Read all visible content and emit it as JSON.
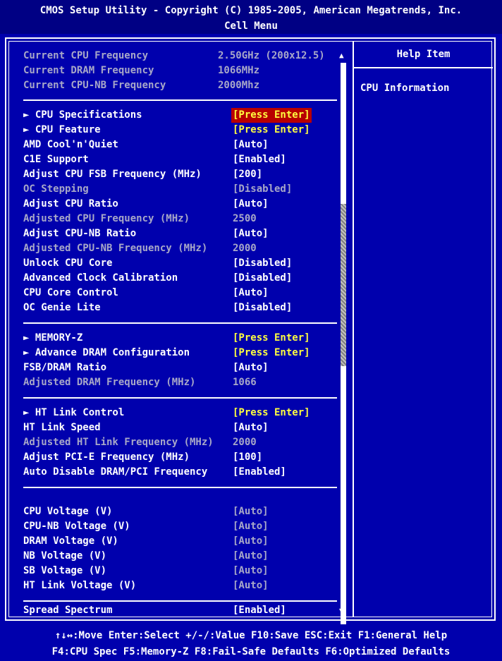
{
  "header": {
    "line1": "CMOS Setup Utility - Copyright (C) 1985-2005, American Megatrends, Inc.",
    "line2": "Cell Menu"
  },
  "help": {
    "title": "Help Item",
    "text": "CPU Information"
  },
  "info": [
    {
      "label": "Current CPU Frequency",
      "value": "2.50GHz (200x12.5)"
    },
    {
      "label": "Current DRAM Frequency",
      "value": "1066MHz"
    },
    {
      "label": "Current CPU-NB Frequency",
      "value": "2000Mhz"
    }
  ],
  "items": {
    "cpu_spec": {
      "label": "► CPU Specifications",
      "value": "[Press Enter]"
    },
    "cpu_feature": {
      "label": "► CPU Feature",
      "value": "[Press Enter]"
    },
    "cool_quiet": {
      "label": "AMD Cool'n'Quiet",
      "value": "[Auto]"
    },
    "c1e": {
      "label": "C1E Support",
      "value": "[Enabled]"
    },
    "fsb": {
      "label": "Adjust CPU FSB Frequency (MHz)",
      "value": "[200]"
    },
    "oc_step": {
      "label": "OC Stepping",
      "value": "[Disabled]"
    },
    "cpu_ratio": {
      "label": "Adjust CPU Ratio",
      "value": "[Auto]"
    },
    "adj_cpu_freq": {
      "label": "Adjusted CPU Frequency (MHz)",
      "value": "2500"
    },
    "nb_ratio": {
      "label": "Adjust CPU-NB Ratio",
      "value": "[Auto]"
    },
    "adj_nb_freq": {
      "label": "Adjusted CPU-NB Frequency (MHz)",
      "value": "2000"
    },
    "unlock": {
      "label": "Unlock CPU Core",
      "value": "[Disabled]"
    },
    "acc": {
      "label": "Advanced Clock Calibration",
      "value": "[Disabled]"
    },
    "core_ctrl": {
      "label": "CPU Core Control",
      "value": "[Auto]"
    },
    "oc_genie": {
      "label": "OC Genie Lite",
      "value": "[Disabled]"
    },
    "memz": {
      "label": "► MEMORY-Z",
      "value": "[Press Enter]"
    },
    "adv_dram": {
      "label": "► Advance DRAM Configuration",
      "value": "[Press Enter]"
    },
    "fsb_dram": {
      "label": "FSB/DRAM Ratio",
      "value": "[Auto]"
    },
    "adj_dram": {
      "label": "Adjusted DRAM Frequency (MHz)",
      "value": "1066"
    },
    "ht_ctrl": {
      "label": "► HT Link Control",
      "value": "[Press Enter]"
    },
    "ht_speed": {
      "label": "HT Link Speed",
      "value": "[Auto]"
    },
    "adj_ht": {
      "label": "Adjusted HT Link Frequency (MHz)",
      "value": "2000"
    },
    "pcie": {
      "label": "Adjust PCI-E Frequency (MHz)",
      "value": "[100]"
    },
    "auto_disable": {
      "label": "Auto Disable DRAM/PCI Frequency",
      "value": "[Enabled]"
    },
    "v_cpu": {
      "label": "CPU Voltage (V)",
      "value": "[Auto]"
    },
    "v_nb_cpu": {
      "label": "CPU-NB Voltage (V)",
      "value": "[Auto]"
    },
    "v_dram": {
      "label": "DRAM Voltage (V)",
      "value": "[Auto]"
    },
    "v_nb": {
      "label": "NB Voltage (V)",
      "value": "[Auto]"
    },
    "v_sb": {
      "label": "SB Voltage (V)",
      "value": "[Auto]"
    },
    "v_ht": {
      "label": "HT Link Voltage (V)",
      "value": "[Auto]"
    },
    "spread": {
      "label": "Spread Spectrum",
      "value": "[Enabled]"
    }
  },
  "footer": {
    "line1": "↑↓↔:Move  Enter:Select  +/-/:Value  F10:Save  ESC:Exit  F1:General Help",
    "line2": "F4:CPU Spec  F5:Memory-Z  F8:Fail-Safe Defaults   F6:Optimized Defaults"
  },
  "colors": {
    "background": "#0000ad",
    "header": "#000084",
    "highlight": "#b80000",
    "submenu_value": "#ffff40",
    "disabled": "#a8a8c8"
  }
}
